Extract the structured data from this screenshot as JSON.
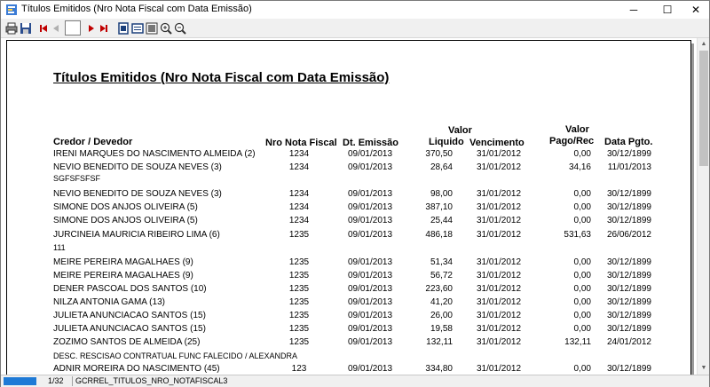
{
  "window": {
    "title": "Títulos Emitidos (Nro Nota Fiscal com Data Emissão)",
    "minimize": "─",
    "maximize": "☐",
    "close": "✕"
  },
  "toolbar": {
    "page_value": ""
  },
  "report": {
    "title": "Títulos Emitidos (Nro Nota Fiscal com Data Emissão)",
    "headers": {
      "credor": "Credor / Devedor",
      "nro_nota": "Nro Nota Fiscal",
      "dt_emissao": "Dt. Emissão",
      "valor_liquido_1": "Valor",
      "valor_liquido_2": "Liquido",
      "vencimento": "Vencimento",
      "valor_pago_1": "Valor",
      "valor_pago_2": "Pago/Rec",
      "data_pgto": "Data Pgto."
    },
    "rows": [
      {
        "credor": "IRENI MARQUES DO NASCIMENTO ALMEIDA (2)",
        "nota": "1234",
        "emissao": "09/01/2013",
        "liquido": "370,50",
        "venc": "31/01/2012",
        "pago": "0,00",
        "pgto": "30/12/1899"
      },
      {
        "credor": "NEVIO BENEDITO DE SOUZA NEVES (3)",
        "nota": "1234",
        "emissao": "09/01/2013",
        "liquido": "28,64",
        "venc": "31/01/2012",
        "pago": "34,16",
        "pgto": "11/01/2013",
        "note": "SGFSFSFSF"
      },
      {
        "credor": "NEVIO BENEDITO DE SOUZA NEVES (3)",
        "nota": "1234",
        "emissao": "09/01/2013",
        "liquido": "98,00",
        "venc": "31/01/2012",
        "pago": "0,00",
        "pgto": "30/12/1899"
      },
      {
        "credor": "SIMONE DOS ANJOS OLIVEIRA (5)",
        "nota": "1234",
        "emissao": "09/01/2013",
        "liquido": "387,10",
        "venc": "31/01/2012",
        "pago": "0,00",
        "pgto": "30/12/1899"
      },
      {
        "credor": "SIMONE DOS ANJOS OLIVEIRA (5)",
        "nota": "1234",
        "emissao": "09/01/2013",
        "liquido": "25,44",
        "venc": "31/01/2012",
        "pago": "0,00",
        "pgto": "30/12/1899"
      },
      {
        "credor": "JURCINEIA MAURICIA RIBEIRO LIMA (6)",
        "nota": "1235",
        "emissao": "09/01/2013",
        "liquido": "486,18",
        "venc": "31/01/2012",
        "pago": "531,63",
        "pgto": "26/06/2012",
        "note": "111"
      },
      {
        "credor": "MEIRE PEREIRA MAGALHAES (9)",
        "nota": "1235",
        "emissao": "09/01/2013",
        "liquido": "51,34",
        "venc": "31/01/2012",
        "pago": "0,00",
        "pgto": "30/12/1899"
      },
      {
        "credor": "MEIRE PEREIRA MAGALHAES (9)",
        "nota": "1235",
        "emissao": "09/01/2013",
        "liquido": "56,72",
        "venc": "31/01/2012",
        "pago": "0,00",
        "pgto": "30/12/1899"
      },
      {
        "credor": "DENER PASCOAL DOS SANTOS (10)",
        "nota": "1235",
        "emissao": "09/01/2013",
        "liquido": "223,60",
        "venc": "31/01/2012",
        "pago": "0,00",
        "pgto": "30/12/1899"
      },
      {
        "credor": "NILZA ANTONIA GAMA (13)",
        "nota": "1235",
        "emissao": "09/01/2013",
        "liquido": "41,20",
        "venc": "31/01/2012",
        "pago": "0,00",
        "pgto": "30/12/1899"
      },
      {
        "credor": "JULIETA ANUNCIACAO SANTOS (15)",
        "nota": "1235",
        "emissao": "09/01/2013",
        "liquido": "26,00",
        "venc": "31/01/2012",
        "pago": "0,00",
        "pgto": "30/12/1899"
      },
      {
        "credor": "JULIETA ANUNCIACAO SANTOS (15)",
        "nota": "1235",
        "emissao": "09/01/2013",
        "liquido": "19,58",
        "venc": "31/01/2012",
        "pago": "0,00",
        "pgto": "30/12/1899"
      },
      {
        "credor": "ZOZIMO SANTOS DE ALMEIDA (25)",
        "nota": "1235",
        "emissao": "09/01/2013",
        "liquido": "132,11",
        "venc": "31/01/2012",
        "pago": "132,11",
        "pgto": "24/01/2012",
        "note": "DESC. RESCISAO CONTRATUAL FUNC FALECIDO / ALEXANDRA"
      },
      {
        "credor": "ADNIR MOREIRA DO NASCIMENTO (45)",
        "nota": "123",
        "emissao": "09/01/2013",
        "liquido": "334,80",
        "venc": "31/01/2012",
        "pago": "0,00",
        "pgto": "30/12/1899"
      }
    ]
  },
  "status": {
    "page": "1/32",
    "report_name": "GCRREL_TITULOS_NRO_NOTAFISCAL3"
  },
  "colors": {
    "progress": "#1e7ad6",
    "nav_red": "#c00000"
  }
}
